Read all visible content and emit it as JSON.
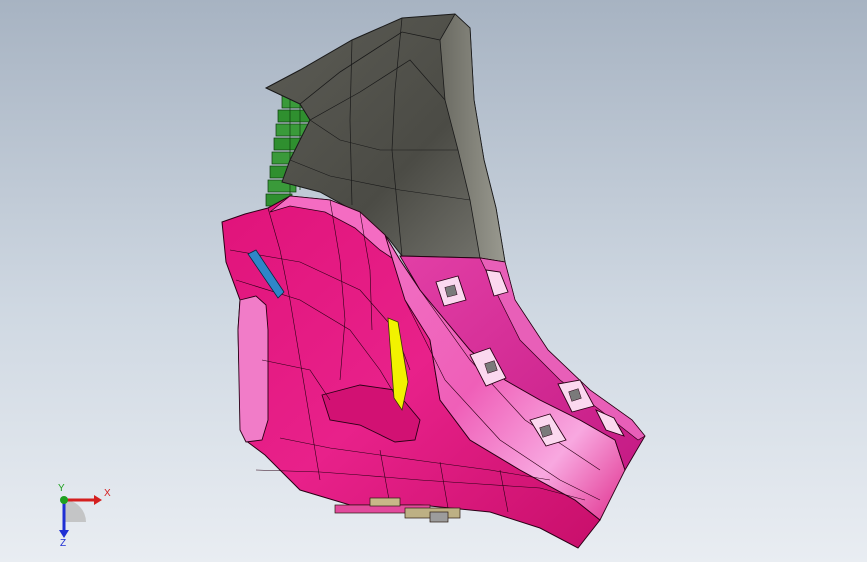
{
  "viewport": {
    "background_top": "#a7b3c2",
    "background_bottom": "#e9edf2"
  },
  "model": {
    "colors": {
      "shell": "#e6167f",
      "shell_light": "#f36bc0",
      "shell_dark": "#b80d60",
      "cover": "#4e4e48",
      "cover_light": "#8a8a80",
      "ribs": "#2f8f2f",
      "accent_yellow": "#f2f200",
      "accent_blue": "#2f86c8"
    }
  },
  "triad": {
    "x_label": "X",
    "y_label": "Y",
    "z_label": "Z",
    "x_color": "#d41f1f",
    "y_color": "#1fa01f",
    "z_color": "#1f2fd4"
  }
}
